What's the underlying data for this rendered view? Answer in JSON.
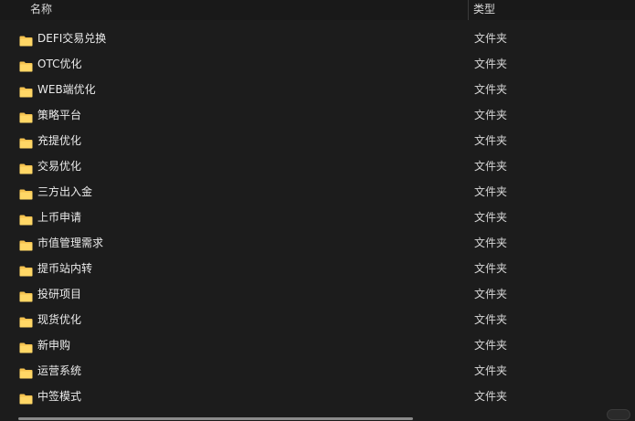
{
  "header": {
    "name_label": "名称",
    "type_label": "类型"
  },
  "files": [
    {
      "name": "DEFI交易兑换",
      "type": "文件夹",
      "icon": "folder-icon"
    },
    {
      "name": "OTC优化",
      "type": "文件夹",
      "icon": "folder-icon"
    },
    {
      "name": "WEB端优化",
      "type": "文件夹",
      "icon": "folder-icon"
    },
    {
      "name": "策略平台",
      "type": "文件夹",
      "icon": "folder-icon"
    },
    {
      "name": "充提优化",
      "type": "文件夹",
      "icon": "folder-icon"
    },
    {
      "name": "交易优化",
      "type": "文件夹",
      "icon": "folder-icon"
    },
    {
      "name": "三方出入金",
      "type": "文件夹",
      "icon": "folder-icon"
    },
    {
      "name": "上币申请",
      "type": "文件夹",
      "icon": "folder-icon"
    },
    {
      "name": "市值管理需求",
      "type": "文件夹",
      "icon": "folder-icon"
    },
    {
      "name": "提币站内转",
      "type": "文件夹",
      "icon": "folder-icon"
    },
    {
      "name": "投研项目",
      "type": "文件夹",
      "icon": "folder-icon"
    },
    {
      "name": "现货优化",
      "type": "文件夹",
      "icon": "folder-icon"
    },
    {
      "name": "新申购",
      "type": "文件夹",
      "icon": "folder-icon"
    },
    {
      "name": "运营系统",
      "type": "文件夹",
      "icon": "folder-icon"
    },
    {
      "name": "中签模式",
      "type": "文件夹",
      "icon": "folder-icon"
    }
  ],
  "colors": {
    "background": "#1c1c1c",
    "folder": "#f4c24f",
    "text": "#ececec"
  }
}
